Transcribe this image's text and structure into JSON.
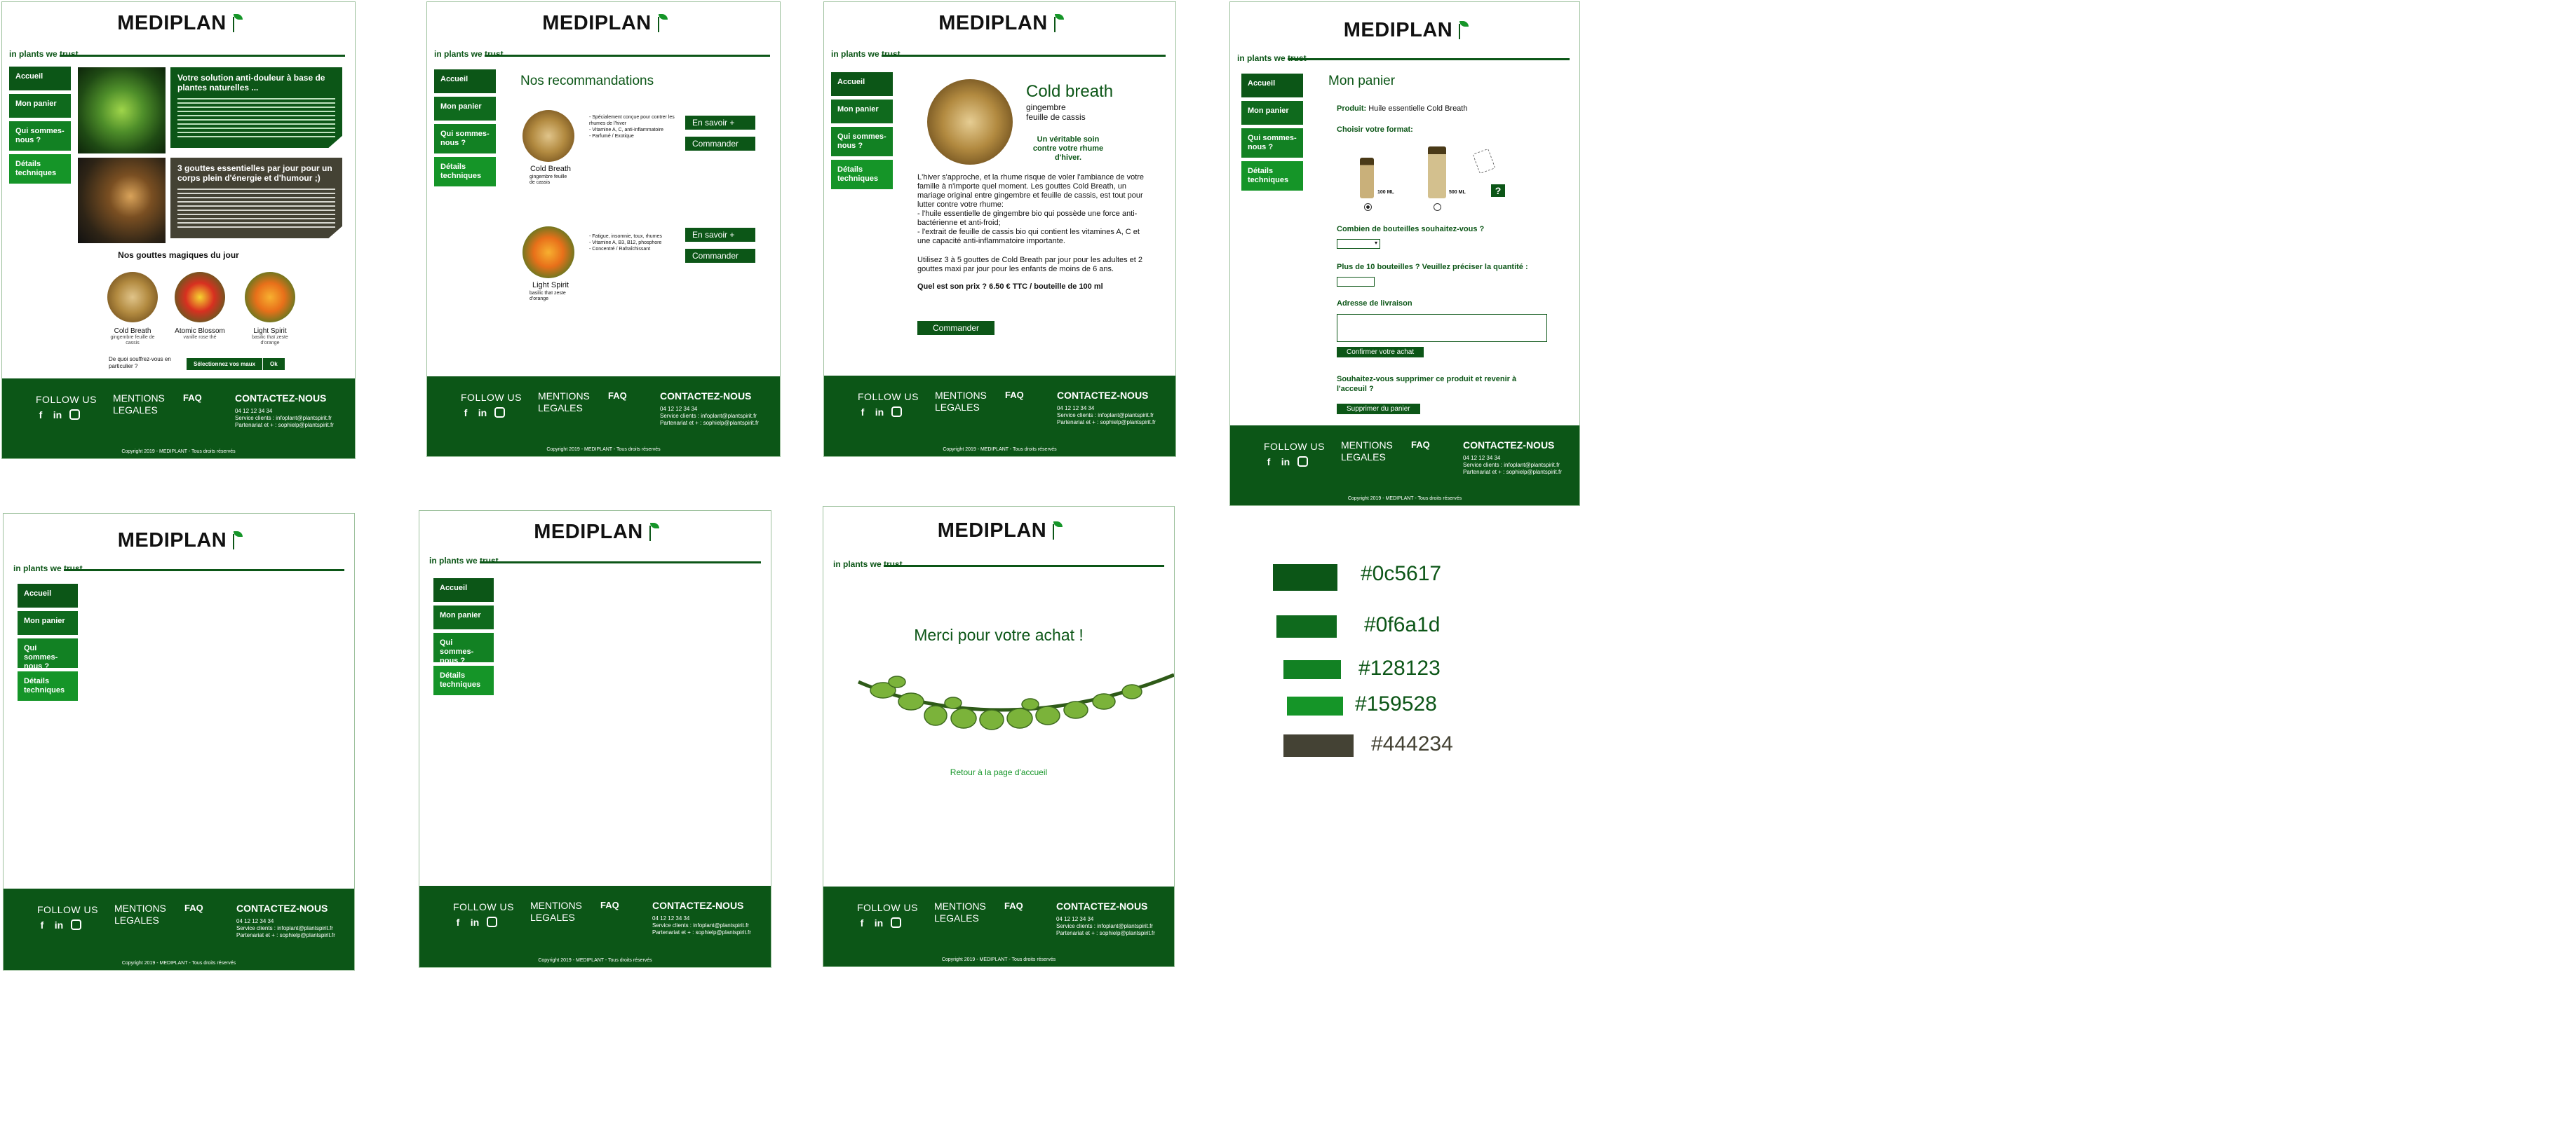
{
  "brand": {
    "logo": "MEDIPLAN",
    "tagline": "in plants we trust"
  },
  "nav": [
    "Accueil",
    "Mon panier",
    "Qui sommes-nous ?",
    "Détails techniques"
  ],
  "footer": {
    "follow": "FOLLOW US",
    "social": [
      "f",
      "in"
    ],
    "mentions": "MENTIONS LEGALES",
    "faq": "FAQ",
    "contact": "CONTACTEZ-NOUS",
    "phone": "04 12 12 34 34",
    "service": "Service clients : infoplant@plantspirit.fr",
    "partner": "Partenariat et + : sophielp@plantspirit.fr",
    "copyright": "Copyright 2019 - MEDIPLANT - Tous droits réservés"
  },
  "home": {
    "hero1_title": "Votre solution anti-douleur à base de plantes naturelles ...",
    "hero2_title": "3 gouttes essentielles par jour pour un corps plein d'énergie et d'humour ;)",
    "section_title": "Nos gouttes magiques du jour",
    "products": [
      {
        "name": "Cold Breath",
        "sub": "gingembre feuille de cassis"
      },
      {
        "name": "Atomic Blossom",
        "sub": "vanille rose thé"
      },
      {
        "name": "Light Spirit",
        "sub": "basilic thaï zeste d'orange"
      }
    ],
    "advice": "De quoi souffrez-vous en particulier ?",
    "select_btn": "Sélectionnez vos maux",
    "ok": "Ok"
  },
  "reco": {
    "title": "Nos recommandations",
    "items": [
      {
        "name": "Cold Breath",
        "sub": "gingembre feuille de cassis",
        "desc": [
          "- Spécialement conçue pour contrer les rhumes de l'hiver",
          "- Vitamine A, C, anti-inflammatoire",
          "- Parfumé / Exotique"
        ]
      },
      {
        "name": "Light Spirit",
        "sub": "basilic thaï zeste d'orange",
        "desc": [
          "- Fatigue, insomnie, toux, rhumes",
          "- Vitamine A, B3, B12, phosphore",
          "- Concentré / Rafraîchissant"
        ]
      }
    ],
    "more": "En savoir +",
    "order": "Commander"
  },
  "detail": {
    "title": "Cold breath",
    "sub1": "gingembre",
    "sub2": "feuille de cassis",
    "slogan": "Un véritable soin contre votre rhume d'hiver.",
    "p1": "L'hiver s'approche, et la rhume risque de voler l'ambiance de votre famille à n'importe quel moment. Les gouttes Cold Breath, un mariage original entre gingembre et feuille de cassis, est tout pour lutter contre votre rhume:",
    "b1": "- l'huile essentielle de gingembre bio qui possède une force anti-bactérienne et anti-froid;",
    "b2": "- l'extrait de feuille de cassis bio qui contient les vitamines A, C et une capacité anti-inflammatoire importante.",
    "p2": "Utilisez 3 à 5 gouttes de Cold Breath par jour pour les adultes et 2 gouttes maxi par jour pour les enfants de moins de 6 ans.",
    "price": "Quel est son prix ? 6.50 € TTC / bouteille de 100 ml",
    "order": "Commander"
  },
  "cart": {
    "title": "Mon panier",
    "product_label": "Produit:",
    "product_value": "Huile essentielle Cold Breath",
    "format": "Choisir votre format:",
    "sizes": [
      "100 ML",
      "500 ML"
    ],
    "q1": "Combien de bouteilles souhaitez-vous ?",
    "q2": "Plus de 10 bouteilles ? Veuillez préciser la quantité :",
    "address": "Adresse de livraison",
    "confirm": "Confirmer votre achat",
    "q3": "Souhaitez-vous supprimer ce produit et revenir à l'acceuil ?",
    "delete": "Supprimer du panier"
  },
  "thanks": {
    "title": "Merci pour votre achat !",
    "back": "Retour à la page d'accueil"
  },
  "palette": [
    {
      "hex": "#0c5617"
    },
    {
      "hex": "#0f6a1d"
    },
    {
      "hex": "#128123"
    },
    {
      "hex": "#159528"
    },
    {
      "hex": "#444234"
    }
  ]
}
